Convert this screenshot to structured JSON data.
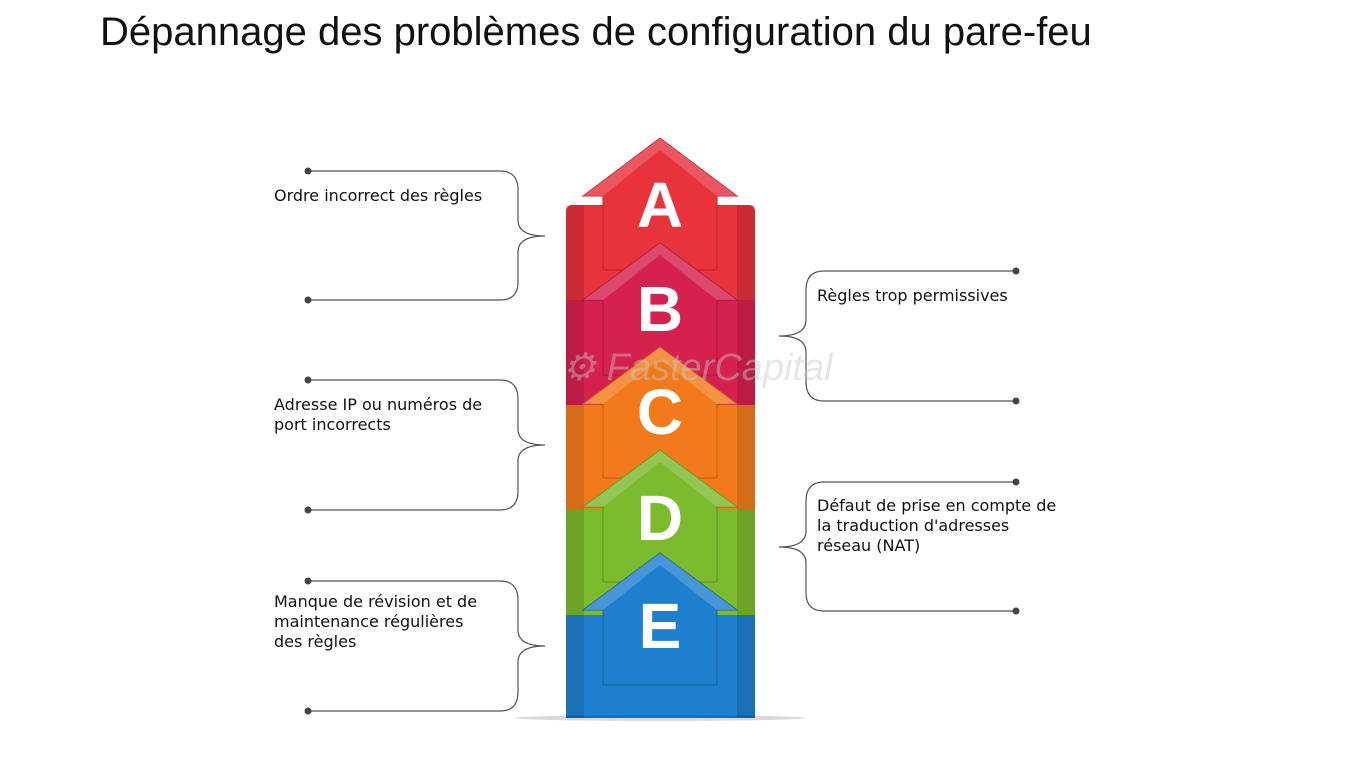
{
  "title": "Dépannage des problèmes de configuration du pare-feu",
  "watermark": "FasterCapital",
  "items": [
    {
      "letter": "A",
      "color": "#e8323c",
      "dark": "#b81c24",
      "label": "Ordre incorrect des règles"
    },
    {
      "letter": "B",
      "color": "#d6204e",
      "dark": "#9e1236",
      "label": "Règles trop permissives"
    },
    {
      "letter": "C",
      "color": "#f27a1a",
      "dark": "#c4570a",
      "label": "Adresse IP ou numéros de port incorrects"
    },
    {
      "letter": "D",
      "color": "#7cba2e",
      "dark": "#4e8a14",
      "label": "Défaut de prise en compte de la traduction d'adresses réseau (NAT)"
    },
    {
      "letter": "E",
      "color": "#1f7fcf",
      "dark": "#0f5a9e",
      "label": "Manque de révision et de maintenance régulières des règles"
    }
  ]
}
